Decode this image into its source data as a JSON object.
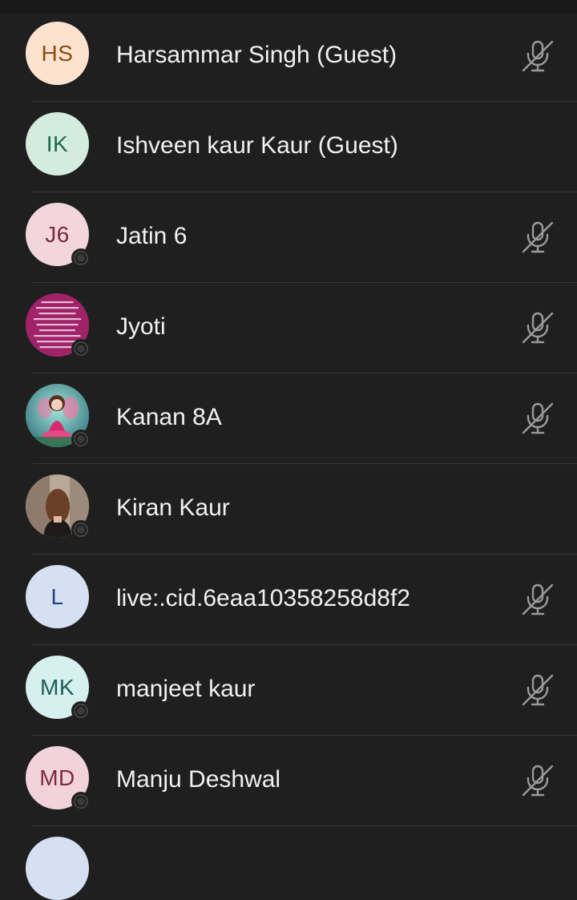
{
  "participants": [
    {
      "name": "Harsammar Singh (Guest)",
      "initials": "HS",
      "avatar_bg": "#fde3cf",
      "avatar_fg": "#8a4d14",
      "presence": false,
      "muted": true
    },
    {
      "name": "Ishveen kaur Kaur (Guest)",
      "initials": "IK",
      "avatar_bg": "#d3ecdd",
      "avatar_fg": "#1e6b47",
      "presence": false,
      "muted": false
    },
    {
      "name": "Jatin 6",
      "initials": "J6",
      "avatar_bg": "#f2d6dc",
      "avatar_fg": "#7a2a3a",
      "presence": true,
      "muted": true
    },
    {
      "name": "Jyoti",
      "initials": "",
      "avatar_kind": "photo-text-pink",
      "avatar_bg": "#a0236a",
      "avatar_fg": "#ffffff",
      "presence": true,
      "muted": true
    },
    {
      "name": "Kanan 8A",
      "initials": "",
      "avatar_kind": "photo-doll",
      "avatar_bg": "#6bb3b6",
      "avatar_fg": "#ffffff",
      "presence": true,
      "muted": true
    },
    {
      "name": "Kiran Kaur",
      "initials": "",
      "avatar_kind": "photo-girl",
      "avatar_bg": "#8a6f5c",
      "avatar_fg": "#ffffff",
      "presence": true,
      "muted": false
    },
    {
      "name": "live:.cid.6eaa10358258d8f2",
      "initials": "L",
      "avatar_bg": "#d5e1f3",
      "avatar_fg": "#27427a",
      "presence": false,
      "muted": true
    },
    {
      "name": "manjeet kaur",
      "initials": "MK",
      "avatar_bg": "#d5f0ee",
      "avatar_fg": "#1e5e5a",
      "presence": true,
      "muted": true
    },
    {
      "name": "Manju Deshwal",
      "initials": "MD",
      "avatar_bg": "#f2d3dc",
      "avatar_fg": "#7b2b43",
      "presence": true,
      "muted": true
    }
  ],
  "icons": {
    "mic_muted": "mic-off-icon",
    "presence": "presence-status-icon"
  },
  "colors": {
    "background": "#1f1f1f",
    "divider": "#343434",
    "text": "#f1f1f1",
    "icon": "#9a9a9a"
  }
}
